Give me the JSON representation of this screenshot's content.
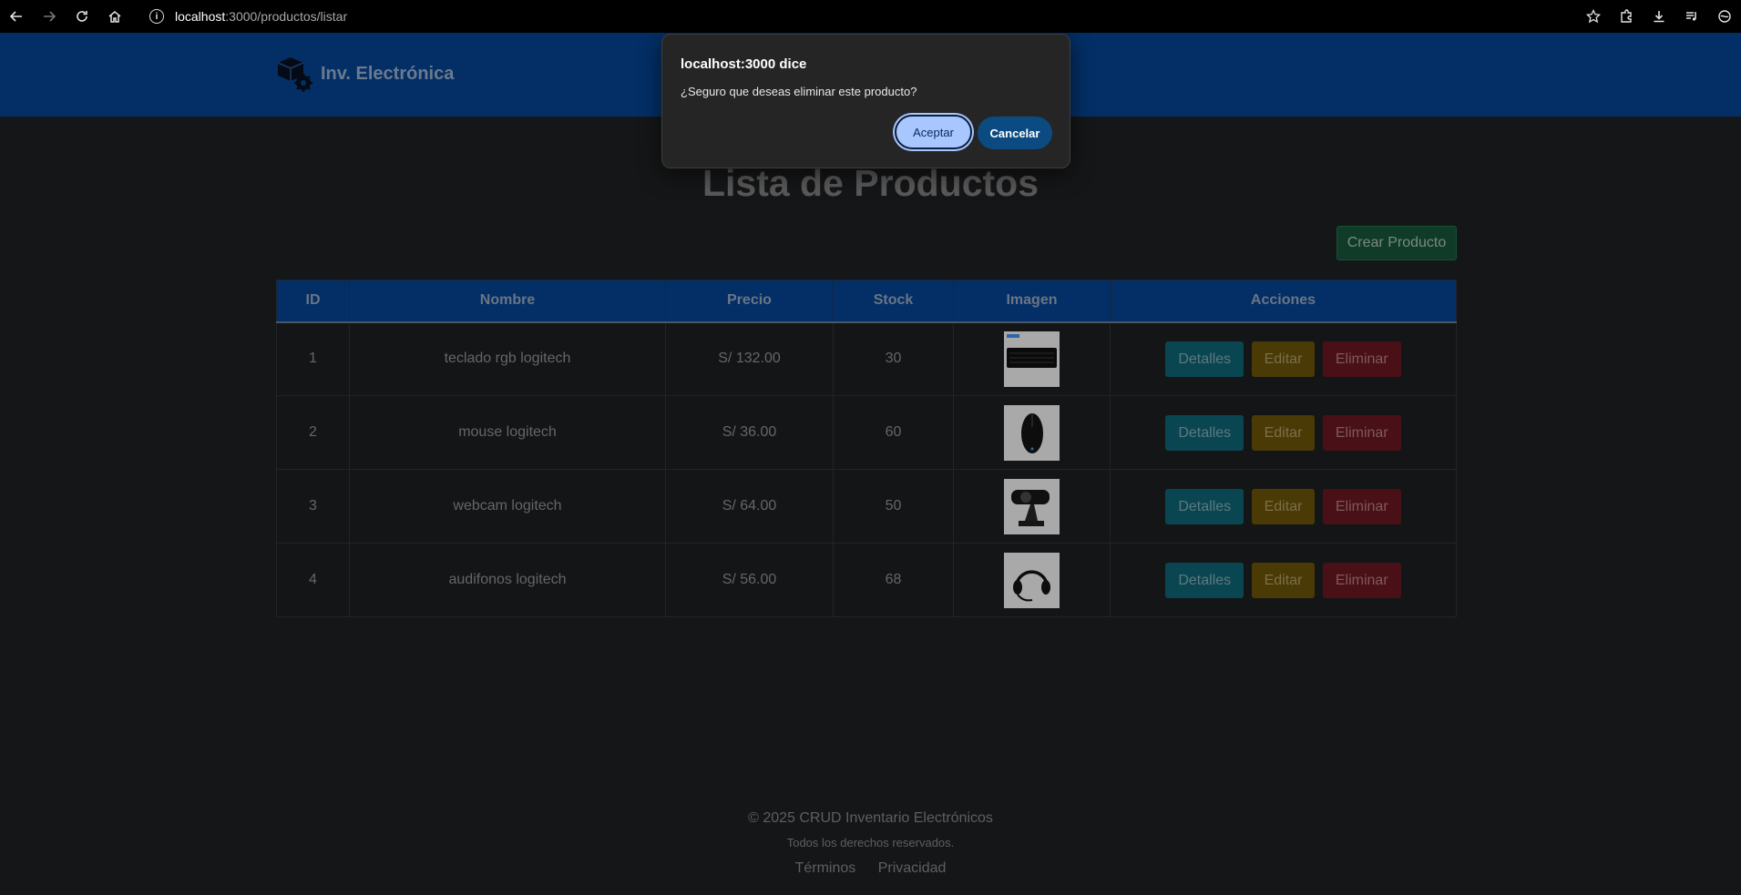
{
  "browser": {
    "url_host": "localhost",
    "url_path": ":3000/productos/listar"
  },
  "header": {
    "brand": "Inv. Electrónica",
    "color": "#032f66"
  },
  "main": {
    "title": "Lista de Productos",
    "create_button": "Crear Producto",
    "columns": [
      "ID",
      "Nombre",
      "Precio",
      "Stock",
      "Imagen",
      "Acciones"
    ],
    "rows": [
      {
        "id": "1",
        "name": "teclado rgb logitech",
        "price": "S/ 132.00",
        "stock": "30",
        "image_icon": "keyboard-image"
      },
      {
        "id": "2",
        "name": "mouse logitech",
        "price": "S/ 36.00",
        "stock": "60",
        "image_icon": "mouse-image"
      },
      {
        "id": "3",
        "name": "webcam logitech",
        "price": "S/ 64.00",
        "stock": "50",
        "image_icon": "webcam-image"
      },
      {
        "id": "4",
        "name": "audifonos logitech",
        "price": "S/ 56.00",
        "stock": "68",
        "image_icon": "headset-image"
      }
    ],
    "actions": {
      "details": "Detalles",
      "edit": "Editar",
      "delete": "Eliminar"
    }
  },
  "footer": {
    "copyright": "© 2025 CRUD Inventario Electrónicos",
    "rights": "Todos los derechos reservados.",
    "terms": "Términos",
    "privacy": "Privacidad"
  },
  "dialog": {
    "title": "localhost:3000 dice",
    "message": "¿Seguro que deseas eliminar este producto?",
    "ok": "Aceptar",
    "cancel": "Cancelar"
  }
}
